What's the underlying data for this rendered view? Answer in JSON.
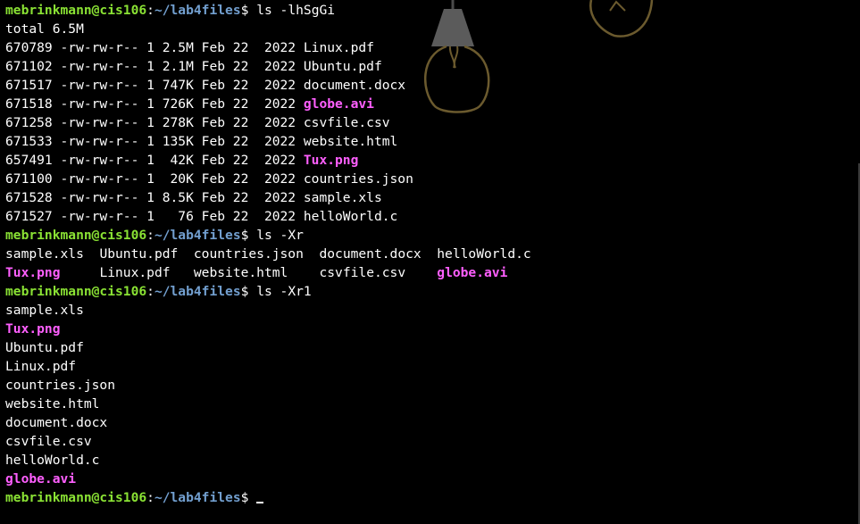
{
  "colors": {
    "background": "#000000",
    "text": "#ffffff",
    "user_host": "#8ae234",
    "path": "#729fcf",
    "media_file": "#ff5fff",
    "wallpaper_bulb": "#5b5b5b",
    "wallpaper_outline": "#6b5a2e"
  },
  "wallpaper": {
    "icon": "light-bulb-icon"
  },
  "prompt": {
    "user_host": "mebrinkmann@cis106",
    "sep": ":",
    "path": "~/lab4files",
    "symbol": "$ "
  },
  "commands": [
    "ls -lhSgGi",
    "ls -Xr",
    "ls -Xr1"
  ],
  "long_listing": {
    "total": "total 6.5M",
    "rows": [
      {
        "meta": "670789 -rw-rw-r-- 1 2.5M Feb 22  2022 ",
        "name": "Linux.pdf",
        "type": "plain"
      },
      {
        "meta": "671102 -rw-rw-r-- 1 2.1M Feb 22  2022 ",
        "name": "Ubuntu.pdf",
        "type": "plain"
      },
      {
        "meta": "671517 -rw-rw-r-- 1 747K Feb 22  2022 ",
        "name": "document.docx",
        "type": "plain"
      },
      {
        "meta": "671518 -rw-rw-r-- 1 726K Feb 22  2022 ",
        "name": "globe.avi",
        "type": "media"
      },
      {
        "meta": "671258 -rw-rw-r-- 1 278K Feb 22  2022 ",
        "name": "csvfile.csv",
        "type": "plain"
      },
      {
        "meta": "671533 -rw-rw-r-- 1 135K Feb 22  2022 ",
        "name": "website.html",
        "type": "plain"
      },
      {
        "meta": "657491 -rw-rw-r-- 1  42K Feb 22  2022 ",
        "name": "Tux.png",
        "type": "media"
      },
      {
        "meta": "671100 -rw-rw-r-- 1  20K Feb 22  2022 ",
        "name": "countries.json",
        "type": "plain"
      },
      {
        "meta": "671528 -rw-rw-r-- 1 8.5K Feb 22  2022 ",
        "name": "sample.xls",
        "type": "plain"
      },
      {
        "meta": "671527 -rw-rw-r-- 1   76 Feb 22  2022 ",
        "name": "helloWorld.c",
        "type": "plain"
      }
    ]
  },
  "columns_listing": {
    "rows": [
      [
        {
          "text": "sample.xls  ",
          "type": "plain"
        },
        {
          "text": "Ubuntu.pdf  ",
          "type": "plain"
        },
        {
          "text": "countries.json  ",
          "type": "plain"
        },
        {
          "text": "document.docx  ",
          "type": "plain"
        },
        {
          "text": "helloWorld.c",
          "type": "plain"
        }
      ],
      [
        {
          "text": "Tux.png",
          "type": "media"
        },
        {
          "text": "     ",
          "type": "plain"
        },
        {
          "text": "Linux.pdf   ",
          "type": "plain"
        },
        {
          "text": "website.html    ",
          "type": "plain"
        },
        {
          "text": "csvfile.csv    ",
          "type": "plain"
        },
        {
          "text": "globe.avi",
          "type": "media"
        }
      ]
    ]
  },
  "single_column_listing": [
    {
      "name": "sample.xls",
      "type": "plain"
    },
    {
      "name": "Tux.png",
      "type": "media"
    },
    {
      "name": "Ubuntu.pdf",
      "type": "plain"
    },
    {
      "name": "Linux.pdf",
      "type": "plain"
    },
    {
      "name": "countries.json",
      "type": "plain"
    },
    {
      "name": "website.html",
      "type": "plain"
    },
    {
      "name": "document.docx",
      "type": "plain"
    },
    {
      "name": "csvfile.csv",
      "type": "plain"
    },
    {
      "name": "helloWorld.c",
      "type": "plain"
    },
    {
      "name": "globe.avi",
      "type": "media"
    }
  ]
}
